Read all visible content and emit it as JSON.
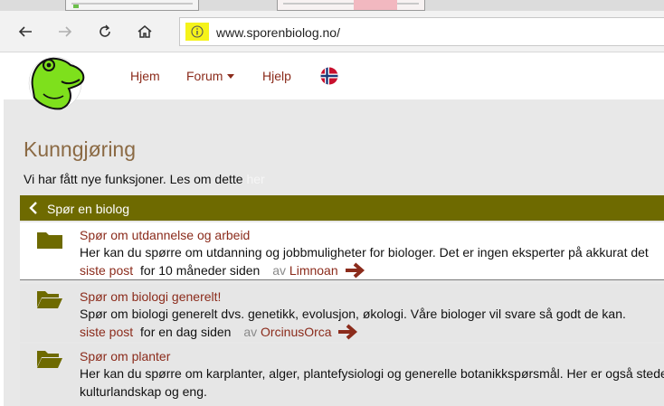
{
  "browser": {
    "url": "www.sporenbiolog.no/"
  },
  "nav": {
    "items": [
      {
        "label": "Hjem"
      },
      {
        "label": "Forum"
      },
      {
        "label": "Hjelp"
      }
    ]
  },
  "announcement": {
    "title": "Kunngjøring",
    "text": "Vi har fått nye funksjoner. Les om dette ",
    "link": "her"
  },
  "section": {
    "title": "Spør en biolog"
  },
  "forums": [
    {
      "title": "Spør om utdannelse og arbeid",
      "description": "Her kan du spørre om utdanning og jobbmuligheter for biologer. Det er ingen eksperter på akkurat det",
      "last_post_label": "siste post",
      "last_post_time": "for 10 måneder siden",
      "by": "av",
      "user": "Limnoan"
    },
    {
      "title": "Spør om biologi generelt!",
      "description": "Spør om biologi generelt dvs. genetikk, evolusjon, økologi. Våre biologer vil svare så godt de kan.",
      "last_post_label": "siste post",
      "last_post_time": "for en dag siden",
      "by": "av",
      "user": "OrcinusOrca"
    },
    {
      "title": "Spør om planter",
      "description": "Her kan du spørre om karplanter, alger, plantefysiologi og generelle botanikkspørsmål. Her er også stedet",
      "description2": "kulturlandskap og eng."
    }
  ],
  "colors": {
    "accent": "#8b2b1b",
    "section_bar": "#6e6a00",
    "folder": "#6e6a00"
  }
}
